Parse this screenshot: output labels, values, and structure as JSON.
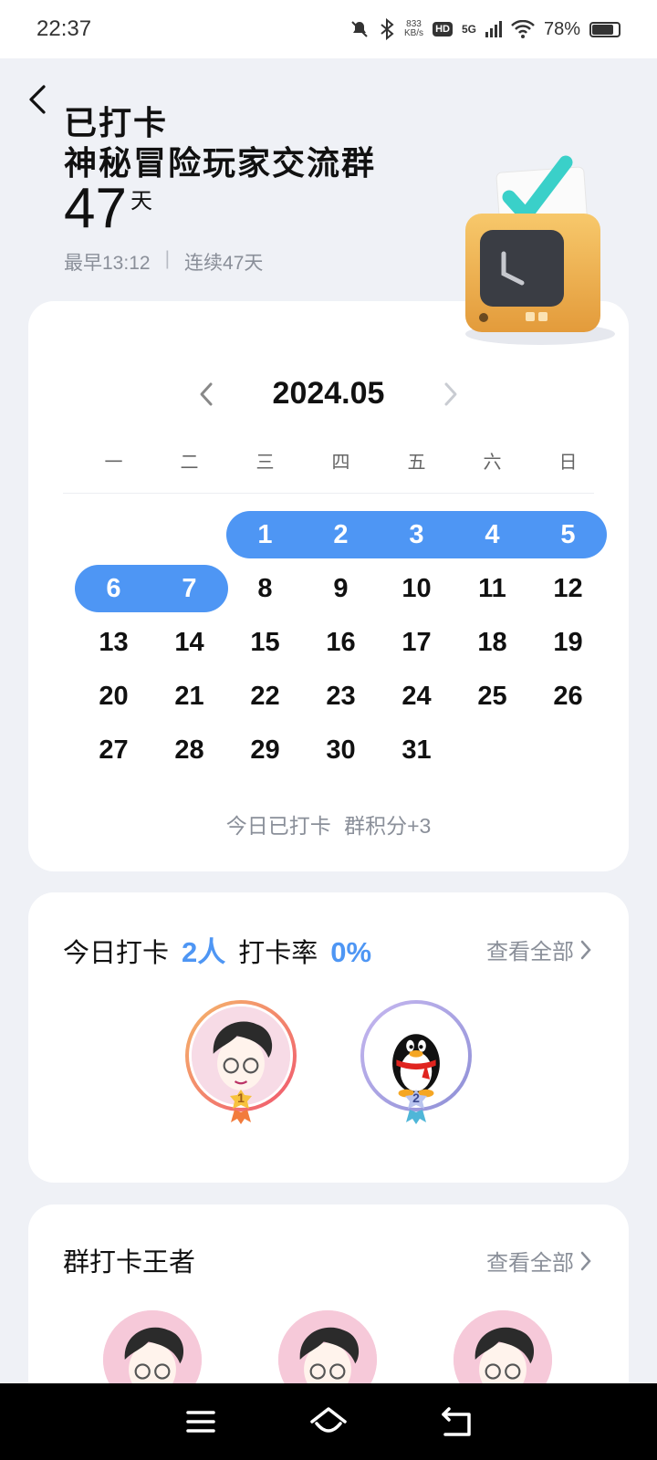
{
  "status_bar": {
    "time": "22:37",
    "speed_value": "833",
    "speed_unit": "KB/s",
    "hd": "HD",
    "network": "5G",
    "battery": "78%",
    "icons": [
      "mute-icon",
      "bluetooth-icon",
      "signal-icon",
      "wifi-icon",
      "battery-icon"
    ]
  },
  "header": {
    "status_title": "已打卡",
    "group_name": "神秘冒险玩家交流群",
    "days_count": "47",
    "days_unit": "天",
    "earliest": "最早13:12",
    "separator": "|",
    "streak": "连续47天"
  },
  "calendar": {
    "month": "2024.05",
    "weekdays": [
      "一",
      "二",
      "三",
      "四",
      "五",
      "六",
      "日"
    ],
    "weeks": [
      [
        "",
        "",
        "1",
        "2",
        "3",
        "4",
        "5"
      ],
      [
        "6",
        "7",
        "8",
        "9",
        "10",
        "11",
        "12"
      ],
      [
        "13",
        "14",
        "15",
        "16",
        "17",
        "18",
        "19"
      ],
      [
        "20",
        "21",
        "22",
        "23",
        "24",
        "25",
        "26"
      ],
      [
        "27",
        "28",
        "29",
        "30",
        "31",
        "",
        ""
      ]
    ],
    "checked_days": [
      "1",
      "2",
      "3",
      "4",
      "5",
      "6",
      "7"
    ],
    "checked_color": "#4e96f4",
    "today_note": "今日已打卡 群积分+3"
  },
  "today_checkin": {
    "label": "今日打卡",
    "count": "2人",
    "rate_label": "打卡率",
    "rate": "0%",
    "view_all": "查看全部",
    "members": [
      {
        "rank": "1",
        "avatar": "cartoon-boy-avatar",
        "ring_color": "#f06a6a"
      },
      {
        "rank": "2",
        "avatar": "qq-penguin-avatar",
        "ring_color": "#9a8fd8"
      }
    ]
  },
  "kings": {
    "title": "群打卡王者",
    "view_all": "查看全部",
    "avatars": [
      "cartoon-boy-avatar",
      "cartoon-boy-avatar",
      "cartoon-boy-avatar"
    ]
  }
}
